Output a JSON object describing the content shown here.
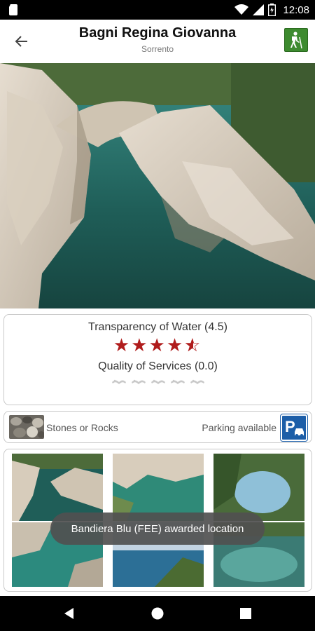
{
  "status_bar": {
    "time": "12:08",
    "icons": [
      "sim-card-icon",
      "wifi-icon",
      "cell-signal-icon",
      "battery-charging-icon"
    ]
  },
  "app_bar": {
    "title": "Bagni Regina Giovanna",
    "subtitle": "Sorrento",
    "back_icon": "arrow-left-icon",
    "action_icon": "hiking-icon"
  },
  "ratings": {
    "water_label": "Transparency of Water (4.5)",
    "water_stars": 4.5,
    "water_stars_max": 5,
    "services_label": "Quality of Services (0.0)",
    "services_rating": 0,
    "services_max": 5,
    "accent_color": "#b01c1c"
  },
  "features": {
    "beach_type": "Stones or Rocks",
    "parking": "Parking available"
  },
  "gallery": {
    "photo_count": 6
  },
  "toast": {
    "message": "Bandiera Blu (FEE) awarded location"
  },
  "nav_bar": {
    "icons": [
      "back-triangle-icon",
      "home-circle-icon",
      "recents-square-icon"
    ]
  }
}
